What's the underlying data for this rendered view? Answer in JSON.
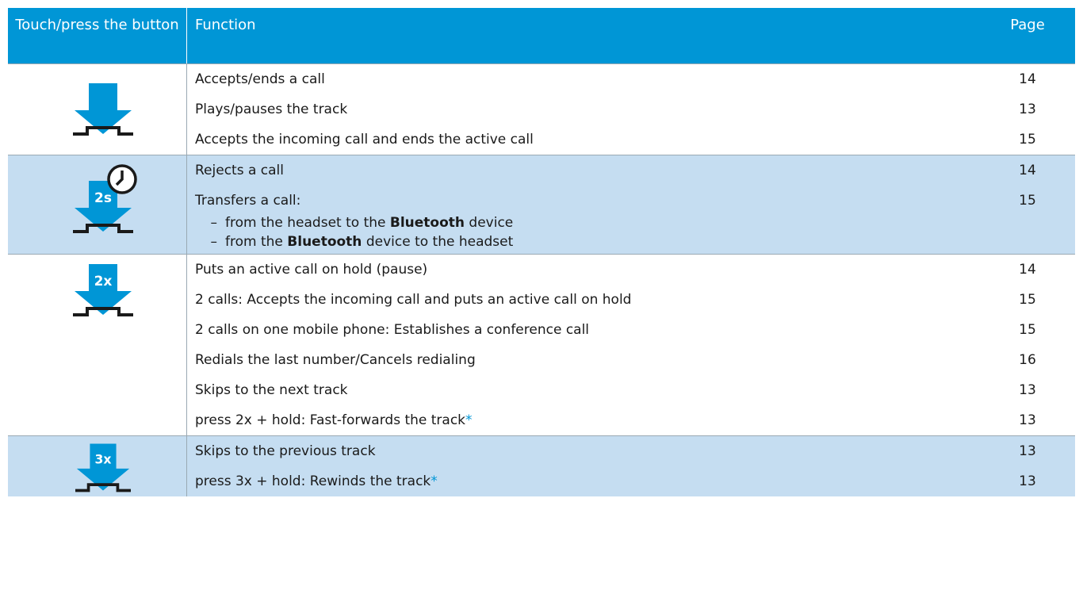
{
  "header": {
    "col_button": "Touch/press the button",
    "col_function": "Function",
    "col_page": "Page"
  },
  "groups": [
    {
      "icon": "press-button-icon",
      "badge": "",
      "rows": [
        {
          "function": "Accepts/ends a call",
          "page": "14"
        },
        {
          "function": "Plays/pauses the track",
          "page": "13"
        },
        {
          "function": "Accepts the incoming call and ends the active call",
          "page": "15"
        }
      ]
    },
    {
      "icon": "press-hold-2s-icon",
      "badge": "2s",
      "rows": [
        {
          "function": "Rejects a call",
          "page": "14"
        },
        {
          "function": "Transfers a call:",
          "page": "15"
        }
      ],
      "sub_items": [
        {
          "dash": "–",
          "before": "from the headset to the",
          "bold": "Bluetooth",
          "after": "device"
        },
        {
          "dash": "–",
          "before": "from the",
          "bold": "Bluetooth",
          "after": "device to the headset"
        }
      ]
    },
    {
      "icon": "press-twice-icon",
      "badge": "2x",
      "rows": [
        {
          "function": "Puts an active call on hold (pause)",
          "page": "14"
        },
        {
          "function": "2 calls: Accepts the incoming call and puts an active call on hold",
          "page": "15"
        },
        {
          "function": "2 calls on one mobile phone: Establishes a conference call",
          "page": "15"
        },
        {
          "function": "Redials the last number/Cancels redialing",
          "page": "16"
        },
        {
          "function": "Skips to the next track",
          "page": "13"
        },
        {
          "function": "press 2x + hold: Fast-forwards the track",
          "star": "*",
          "page": "13"
        }
      ]
    },
    {
      "icon": "press-three-times-icon",
      "badge": "3x",
      "rows": [
        {
          "function": "Skips to the previous track",
          "page": "13"
        },
        {
          "function": "press 3x + hold: Rewinds the track",
          "star": "*",
          "page": "13"
        }
      ]
    }
  ],
  "colors": {
    "header_bg": "#0096d6",
    "arrow_blue": "#0096d6",
    "band_blue": "#c5ddf1"
  }
}
